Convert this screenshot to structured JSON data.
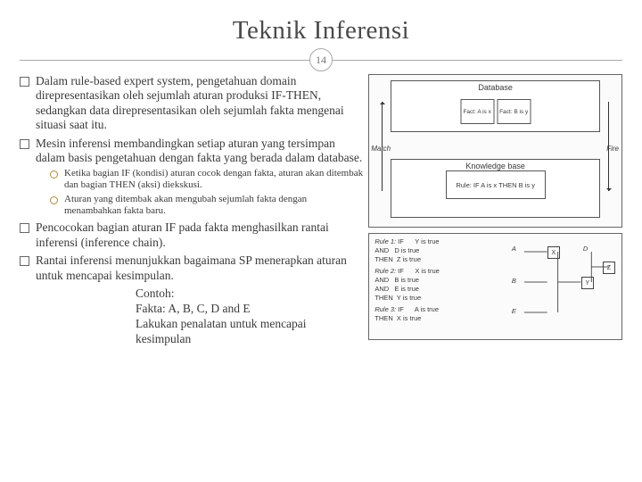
{
  "title": "Teknik Inferensi",
  "slide_number": "14",
  "bullets": [
    "Dalam rule-based expert system, pengetahuan domain direpresentasikan oleh sejumlah aturan produksi IF-THEN, sedangkan data direpresentasikan oleh sejumlah fakta mengenai situasi saat itu.",
    "Mesin inferensi membandingkan setiap aturan yang tersimpan dalam basis pengetahuan dengan fakta yang berada dalam database."
  ],
  "sub_bullets": [
    "Ketika bagian IF (kondisi) aturan cocok dengan fakta, aturan akan ditembak dan bagian THEN (aksi) diekskusi.",
    "Aturan yang ditembak akan mengubah sejumlah fakta dengan menambahkan fakta baru."
  ],
  "bullets2": [
    "Pencocokan bagian aturan IF pada fakta menghasilkan rantai inferensi (inference chain).",
    "Rantai inferensi menunjukkan bagaimana SP menerapkan aturan untuk mencapai kesimpulan."
  ],
  "contoh": {
    "h": "Contoh:",
    "l1": "Fakta: A, B, C, D and E",
    "l2": "Lakukan penalatan untuk mencapai kesimpulan"
  },
  "fig1": {
    "db": "Database",
    "kb": "Knowledge base",
    "factA": "Fact: A is x",
    "factB": "Fact: B is y",
    "rule": "Rule: IF A is x THEN B is y",
    "match": "Match",
    "fire": "Fire"
  },
  "fig2": {
    "r1h": "Rule 1:",
    "r1": "IF      Y is true\nAND   D is true\nTHEN  Z is true",
    "r2h": "Rule 2:",
    "r2": "IF      X is true\nAND   B is true\nAND   E is true\nTHEN  Y is true",
    "r3h": "Rule 3:",
    "r3": "IF      A is true\nTHEN  X is true",
    "nodes": {
      "A": "A",
      "X": "X",
      "B": "B",
      "E": "E",
      "Y": "Y",
      "D": "D",
      "Z": "Z"
    }
  }
}
